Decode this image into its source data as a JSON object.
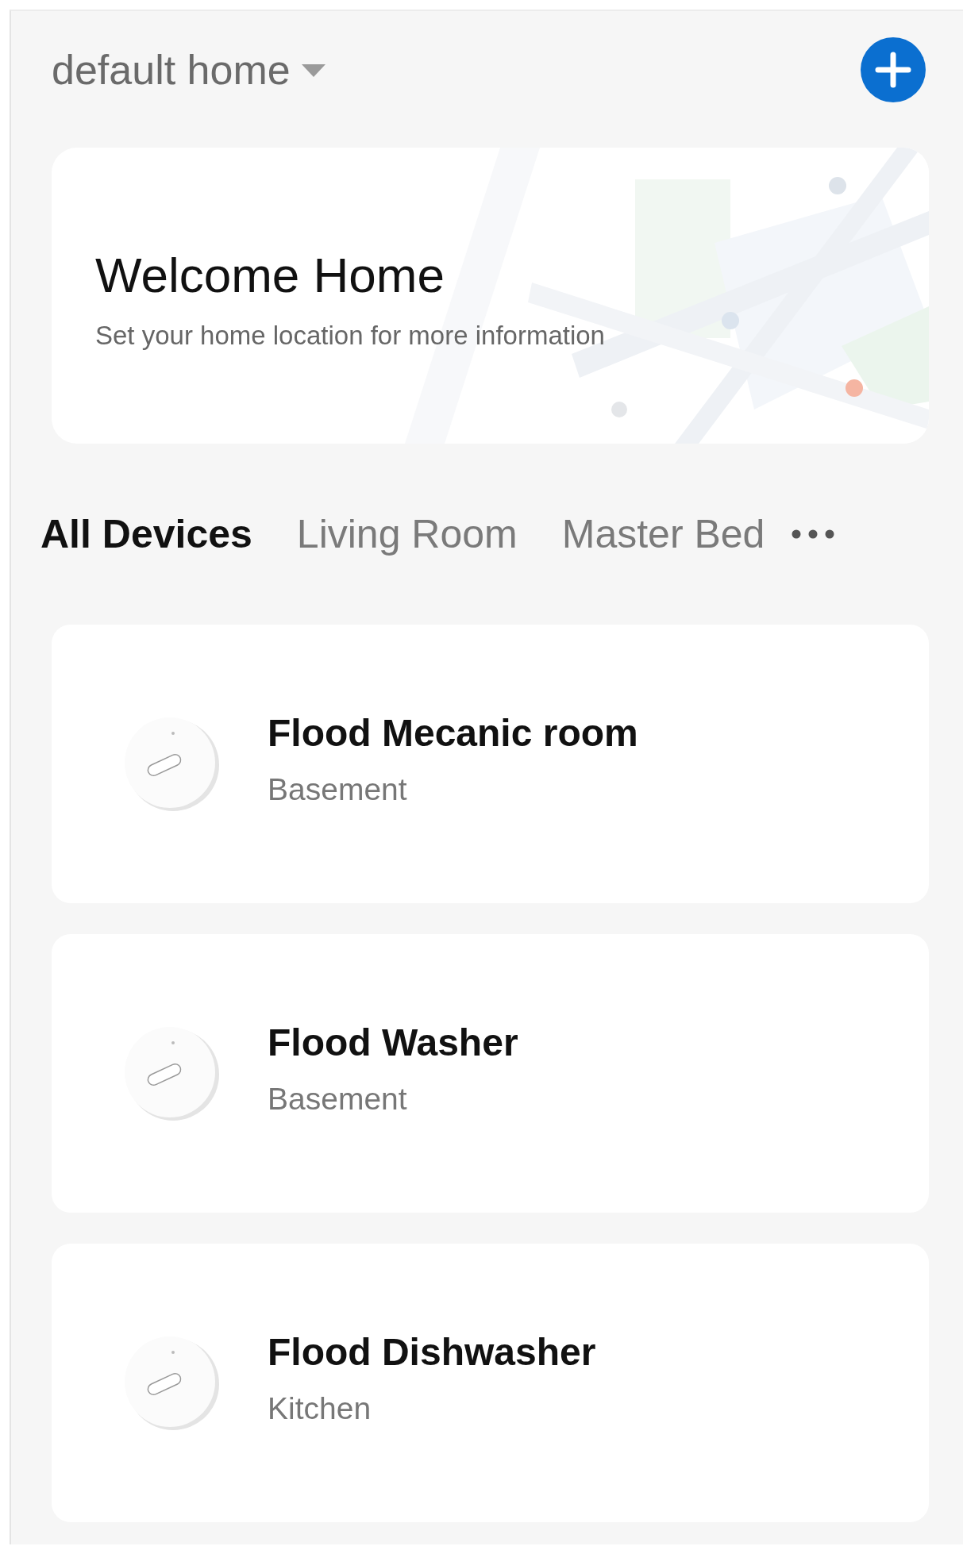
{
  "header": {
    "home_name": "default home"
  },
  "welcome": {
    "title": "Welcome Home",
    "subtitle": "Set your home location for more information"
  },
  "tabs": [
    {
      "label": "All Devices",
      "selected": true
    },
    {
      "label": "Living Room",
      "selected": false
    },
    {
      "label": "Master Bed",
      "selected": false
    }
  ],
  "devices": [
    {
      "name": "Flood Mecanic room",
      "room": "Basement"
    },
    {
      "name": "Flood Washer",
      "room": "Basement"
    },
    {
      "name": "Flood Dishwasher",
      "room": "Kitchen"
    }
  ]
}
